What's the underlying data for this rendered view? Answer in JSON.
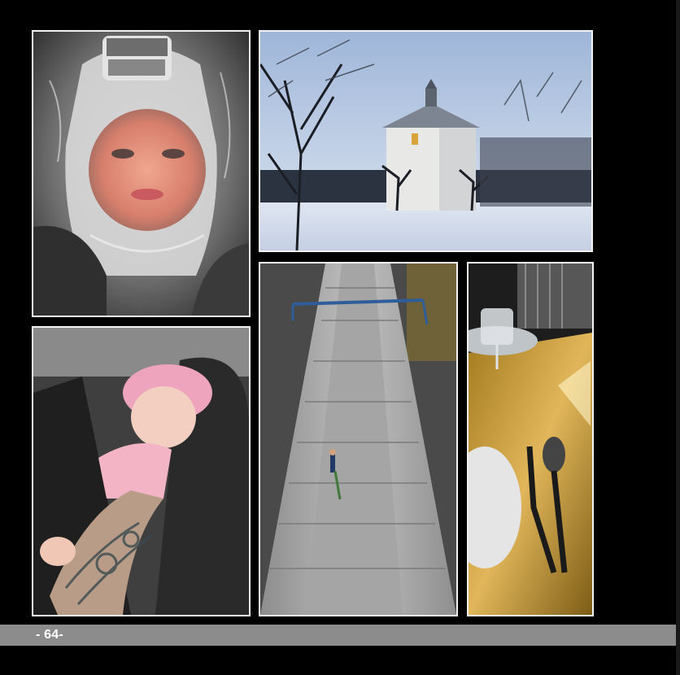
{
  "page": {
    "page_number": "- 64-",
    "background_color": "#000000",
    "footer_color": "#8c8c8c"
  },
  "photos": [
    {
      "id": "ice-face",
      "subject": "child-face-behind-ice"
    },
    {
      "id": "chapel",
      "subject": "white-chapel-in-snow"
    },
    {
      "id": "baby",
      "subject": "sleeping-baby-on-tattooed-arm"
    },
    {
      "id": "roof",
      "subject": "worker-on-long-metal-roof"
    },
    {
      "id": "table",
      "subject": "glass-and-cutlery-on-table"
    }
  ]
}
